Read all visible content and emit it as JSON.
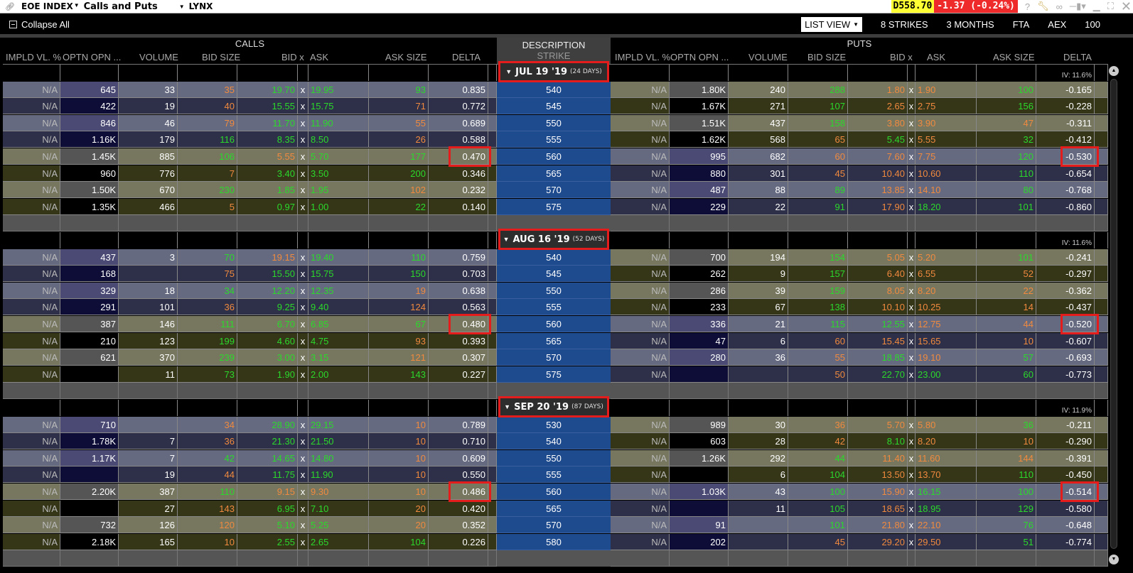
{
  "titlebar": {
    "symbol": "EOE INDEX",
    "title": "Calls and Puts",
    "account": "LYNX",
    "price": "D558.70",
    "change": "-1.37 (-0.24%)",
    "icons": [
      "help-icon",
      "wrench-icon",
      "link-icon",
      "pin-icon",
      "minimize-icon",
      "maximize-icon",
      "close-icon"
    ]
  },
  "toolbar": {
    "collapse_all": "Collapse All",
    "view": "LIST VIEW",
    "strikes": "8 STRIKES",
    "months": "3 MONTHS",
    "exchange1": "FTA",
    "exchange2": "AEX",
    "multiplier": "100"
  },
  "headers": {
    "calls": "CALLS",
    "puts": "PUTS",
    "description": "DESCRIPTION",
    "strike": "STRIKE",
    "columns": {
      "impl_vol": "IMPLD VL. %",
      "open_int": "OPTN OPN ...",
      "volume": "VOLUME",
      "bid_size": "BID SIZE",
      "bid_x": "BID x",
      "ask": "ASK",
      "ask_size": "ASK SIZE",
      "delta": "DELTA"
    }
  },
  "colors": {
    "up": "#2bd92b",
    "down": "#f08a3e",
    "strike_bg": "#1e4a8e",
    "highlight": "#e41c1c"
  },
  "expirations": [
    {
      "date": "JUL 19 '19",
      "days": "(24 DAYS)",
      "iv": "IV: 11.6%",
      "atm_strike": "560",
      "rows": [
        {
          "strike": "540",
          "c": {
            "iv": "N/A",
            "oi": "645",
            "vol": "33",
            "bs": "35",
            "bsc": "o",
            "bid": "19.70",
            "bidc": "g",
            "ask": "19.95",
            "askc": "g",
            "as": "93",
            "asc": "g",
            "delta": "0.835"
          },
          "p": {
            "iv": "N/A",
            "oi": "1.80K",
            "vol": "240",
            "bs": "288",
            "bsc": "g",
            "bid": "1.80",
            "bidc": "o",
            "ask": "1.90",
            "askc": "o",
            "as": "100",
            "asc": "g",
            "delta": "-0.165"
          }
        },
        {
          "strike": "545",
          "c": {
            "iv": "N/A",
            "oi": "422",
            "vol": "19",
            "bs": "40",
            "bsc": "o",
            "bid": "15.55",
            "bidc": "g",
            "ask": "15.75",
            "askc": "g",
            "as": "71",
            "asc": "o",
            "delta": "0.772"
          },
          "p": {
            "iv": "N/A",
            "oi": "1.67K",
            "vol": "271",
            "bs": "107",
            "bsc": "g",
            "bid": "2.65",
            "bidc": "o",
            "ask": "2.75",
            "askc": "o",
            "as": "156",
            "asc": "g",
            "delta": "-0.228"
          }
        },
        {
          "strike": "550",
          "c": {
            "iv": "N/A",
            "oi": "846",
            "vol": "46",
            "bs": "79",
            "bsc": "o",
            "bid": "11.70",
            "bidc": "g",
            "ask": "11.90",
            "askc": "g",
            "as": "55",
            "asc": "o",
            "delta": "0.689"
          },
          "p": {
            "iv": "N/A",
            "oi": "1.51K",
            "vol": "437",
            "bs": "158",
            "bsc": "g",
            "bid": "3.80",
            "bidc": "o",
            "ask": "3.90",
            "askc": "o",
            "as": "47",
            "asc": "o",
            "delta": "-0.311"
          }
        },
        {
          "strike": "555",
          "c": {
            "iv": "N/A",
            "oi": "1.16K",
            "vol": "179",
            "bs": "116",
            "bsc": "g",
            "bid": "8.35",
            "bidc": "g",
            "ask": "8.50",
            "askc": "g",
            "as": "26",
            "asc": "o",
            "delta": "0.588"
          },
          "p": {
            "iv": "N/A",
            "oi": "1.62K",
            "vol": "568",
            "bs": "65",
            "bsc": "o",
            "bid": "5.45",
            "bidc": "g",
            "ask": "5.55",
            "askc": "o",
            "as": "32",
            "asc": "g",
            "delta": "-0.412"
          }
        },
        {
          "strike": "560",
          "c": {
            "iv": "N/A",
            "oi": "1.45K",
            "vol": "885",
            "bs": "106",
            "bsc": "g",
            "bid": "5.55",
            "bidc": "o",
            "ask": "5.70",
            "askc": "g",
            "as": "177",
            "asc": "g",
            "delta": "0.470"
          },
          "p": {
            "iv": "N/A",
            "oi": "995",
            "vol": "682",
            "bs": "60",
            "bsc": "o",
            "bid": "7.60",
            "bidc": "o",
            "ask": "7.75",
            "askc": "o",
            "as": "120",
            "asc": "g",
            "delta": "-0.530"
          }
        },
        {
          "strike": "565",
          "c": {
            "iv": "N/A",
            "oi": "960",
            "vol": "776",
            "bs": "7",
            "bsc": "o",
            "bid": "3.40",
            "bidc": "g",
            "ask": "3.50",
            "askc": "g",
            "as": "200",
            "asc": "g",
            "delta": "0.346"
          },
          "p": {
            "iv": "N/A",
            "oi": "880",
            "vol": "301",
            "bs": "45",
            "bsc": "o",
            "bid": "10.40",
            "bidc": "o",
            "ask": "10.60",
            "askc": "o",
            "as": "110",
            "asc": "g",
            "delta": "-0.654"
          }
        },
        {
          "strike": "570",
          "c": {
            "iv": "N/A",
            "oi": "1.50K",
            "vol": "670",
            "bs": "230",
            "bsc": "g",
            "bid": "1.85",
            "bidc": "g",
            "ask": "1.95",
            "askc": "g",
            "as": "102",
            "asc": "o",
            "delta": "0.232"
          },
          "p": {
            "iv": "N/A",
            "oi": "487",
            "vol": "88",
            "bs": "89",
            "bsc": "g",
            "bid": "13.85",
            "bidc": "o",
            "ask": "14.10",
            "askc": "o",
            "as": "80",
            "asc": "g",
            "delta": "-0.768"
          }
        },
        {
          "strike": "575",
          "c": {
            "iv": "N/A",
            "oi": "1.35K",
            "vol": "466",
            "bs": "5",
            "bsc": "o",
            "bid": "0.97",
            "bidc": "g",
            "ask": "1.00",
            "askc": "g",
            "as": "22",
            "asc": "g",
            "delta": "0.140"
          },
          "p": {
            "iv": "N/A",
            "oi": "229",
            "vol": "22",
            "bs": "91",
            "bsc": "g",
            "bid": "17.90",
            "bidc": "o",
            "ask": "18.20",
            "askc": "g",
            "as": "101",
            "asc": "g",
            "delta": "-0.860"
          }
        }
      ]
    },
    {
      "date": "AUG 16 '19",
      "days": "(52 DAYS)",
      "iv": "IV: 11.6%",
      "atm_strike": "560",
      "rows": [
        {
          "strike": "540",
          "c": {
            "iv": "N/A",
            "oi": "437",
            "vol": "3",
            "bs": "70",
            "bsc": "g",
            "bid": "19.15",
            "bidc": "o",
            "ask": "19.40",
            "askc": "g",
            "as": "110",
            "asc": "g",
            "delta": "0.759"
          },
          "p": {
            "iv": "N/A",
            "oi": "700",
            "vol": "194",
            "bs": "154",
            "bsc": "g",
            "bid": "5.05",
            "bidc": "o",
            "ask": "5.20",
            "askc": "o",
            "as": "101",
            "asc": "g",
            "delta": "-0.241"
          }
        },
        {
          "strike": "545",
          "c": {
            "iv": "N/A",
            "oi": "168",
            "vol": "",
            "bs": "75",
            "bsc": "o",
            "bid": "15.50",
            "bidc": "g",
            "ask": "15.75",
            "askc": "g",
            "as": "150",
            "asc": "g",
            "delta": "0.703"
          },
          "p": {
            "iv": "N/A",
            "oi": "262",
            "vol": "9",
            "bs": "157",
            "bsc": "g",
            "bid": "6.40",
            "bidc": "o",
            "ask": "6.55",
            "askc": "o",
            "as": "52",
            "asc": "o",
            "delta": "-0.297"
          }
        },
        {
          "strike": "550",
          "c": {
            "iv": "N/A",
            "oi": "329",
            "vol": "18",
            "bs": "34",
            "bsc": "g",
            "bid": "12.20",
            "bidc": "g",
            "ask": "12.35",
            "askc": "g",
            "as": "19",
            "asc": "o",
            "delta": "0.638"
          },
          "p": {
            "iv": "N/A",
            "oi": "286",
            "vol": "39",
            "bs": "159",
            "bsc": "g",
            "bid": "8.05",
            "bidc": "o",
            "ask": "8.20",
            "askc": "o",
            "as": "22",
            "asc": "o",
            "delta": "-0.362"
          }
        },
        {
          "strike": "555",
          "c": {
            "iv": "N/A",
            "oi": "291",
            "vol": "101",
            "bs": "36",
            "bsc": "o",
            "bid": "9.25",
            "bidc": "g",
            "ask": "9.40",
            "askc": "g",
            "as": "124",
            "asc": "o",
            "delta": "0.563"
          },
          "p": {
            "iv": "N/A",
            "oi": "233",
            "vol": "67",
            "bs": "138",
            "bsc": "g",
            "bid": "10.10",
            "bidc": "o",
            "ask": "10.25",
            "askc": "o",
            "as": "14",
            "asc": "o",
            "delta": "-0.437"
          }
        },
        {
          "strike": "560",
          "c": {
            "iv": "N/A",
            "oi": "387",
            "vol": "146",
            "bs": "111",
            "bsc": "g",
            "bid": "6.70",
            "bidc": "g",
            "ask": "6.85",
            "askc": "g",
            "as": "67",
            "asc": "g",
            "delta": "0.480"
          },
          "p": {
            "iv": "N/A",
            "oi": "336",
            "vol": "21",
            "bs": "115",
            "bsc": "g",
            "bid": "12.55",
            "bidc": "g",
            "ask": "12.75",
            "askc": "o",
            "as": "44",
            "asc": "o",
            "delta": "-0.520"
          }
        },
        {
          "strike": "565",
          "c": {
            "iv": "N/A",
            "oi": "210",
            "vol": "123",
            "bs": "199",
            "bsc": "g",
            "bid": "4.60",
            "bidc": "g",
            "ask": "4.75",
            "askc": "g",
            "as": "93",
            "asc": "o",
            "delta": "0.393"
          },
          "p": {
            "iv": "N/A",
            "oi": "47",
            "vol": "6",
            "bs": "60",
            "bsc": "o",
            "bid": "15.45",
            "bidc": "o",
            "ask": "15.65",
            "askc": "o",
            "as": "10",
            "asc": "o",
            "delta": "-0.607"
          }
        },
        {
          "strike": "570",
          "c": {
            "iv": "N/A",
            "oi": "621",
            "vol": "370",
            "bs": "239",
            "bsc": "g",
            "bid": "3.00",
            "bidc": "g",
            "ask": "3.15",
            "askc": "g",
            "as": "121",
            "asc": "o",
            "delta": "0.307"
          },
          "p": {
            "iv": "N/A",
            "oi": "280",
            "vol": "36",
            "bs": "55",
            "bsc": "o",
            "bid": "18.85",
            "bidc": "g",
            "ask": "19.10",
            "askc": "o",
            "as": "57",
            "asc": "g",
            "delta": "-0.693"
          }
        },
        {
          "strike": "575",
          "c": {
            "iv": "N/A",
            "oi": "",
            "vol": "11",
            "bs": "73",
            "bsc": "g",
            "bid": "1.90",
            "bidc": "g",
            "ask": "2.00",
            "askc": "g",
            "as": "143",
            "asc": "g",
            "delta": "0.227"
          },
          "p": {
            "iv": "N/A",
            "oi": "",
            "vol": "",
            "bs": "50",
            "bsc": "o",
            "bid": "22.70",
            "bidc": "g",
            "ask": "23.00",
            "askc": "g",
            "as": "60",
            "asc": "g",
            "delta": "-0.773"
          }
        }
      ]
    },
    {
      "date": "SEP 20 '19",
      "days": "(87 DAYS)",
      "iv": "IV: 11.9%",
      "atm_strike": "560",
      "rows": [
        {
          "strike": "530",
          "c": {
            "iv": "N/A",
            "oi": "710",
            "vol": "",
            "bs": "34",
            "bsc": "o",
            "bid": "28.90",
            "bidc": "g",
            "ask": "29.15",
            "askc": "g",
            "as": "10",
            "asc": "o",
            "delta": "0.789"
          },
          "p": {
            "iv": "N/A",
            "oi": "989",
            "vol": "30",
            "bs": "36",
            "bsc": "o",
            "bid": "5.70",
            "bidc": "o",
            "ask": "5.80",
            "askc": "o",
            "as": "36",
            "asc": "g",
            "delta": "-0.211"
          }
        },
        {
          "strike": "540",
          "c": {
            "iv": "N/A",
            "oi": "1.78K",
            "vol": "7",
            "bs": "36",
            "bsc": "o",
            "bid": "21.30",
            "bidc": "g",
            "ask": "21.50",
            "askc": "g",
            "as": "10",
            "asc": "o",
            "delta": "0.710"
          },
          "p": {
            "iv": "N/A",
            "oi": "603",
            "vol": "28",
            "bs": "42",
            "bsc": "o",
            "bid": "8.10",
            "bidc": "g",
            "ask": "8.20",
            "askc": "o",
            "as": "10",
            "asc": "o",
            "delta": "-0.290"
          }
        },
        {
          "strike": "550",
          "c": {
            "iv": "N/A",
            "oi": "1.17K",
            "vol": "7",
            "bs": "42",
            "bsc": "g",
            "bid": "14.65",
            "bidc": "g",
            "ask": "14.80",
            "askc": "g",
            "as": "10",
            "asc": "o",
            "delta": "0.609"
          },
          "p": {
            "iv": "N/A",
            "oi": "1.26K",
            "vol": "292",
            "bs": "44",
            "bsc": "g",
            "bid": "11.40",
            "bidc": "o",
            "ask": "11.60",
            "askc": "o",
            "as": "144",
            "asc": "o",
            "delta": "-0.391"
          }
        },
        {
          "strike": "555",
          "c": {
            "iv": "N/A",
            "oi": "",
            "vol": "19",
            "bs": "44",
            "bsc": "o",
            "bid": "11.75",
            "bidc": "g",
            "ask": "11.90",
            "askc": "g",
            "as": "10",
            "asc": "o",
            "delta": "0.550"
          },
          "p": {
            "iv": "N/A",
            "oi": "",
            "vol": "6",
            "bs": "104",
            "bsc": "g",
            "bid": "13.50",
            "bidc": "o",
            "ask": "13.70",
            "askc": "o",
            "as": "110",
            "asc": "g",
            "delta": "-0.450"
          }
        },
        {
          "strike": "560",
          "c": {
            "iv": "N/A",
            "oi": "2.20K",
            "vol": "387",
            "bs": "110",
            "bsc": "g",
            "bid": "9.15",
            "bidc": "o",
            "ask": "9.30",
            "askc": "o",
            "as": "10",
            "asc": "o",
            "delta": "0.486"
          },
          "p": {
            "iv": "N/A",
            "oi": "1.03K",
            "vol": "43",
            "bs": "100",
            "bsc": "g",
            "bid": "15.90",
            "bidc": "o",
            "ask": "16.15",
            "askc": "g",
            "as": "100",
            "asc": "g",
            "delta": "-0.514"
          }
        },
        {
          "strike": "565",
          "c": {
            "iv": "N/A",
            "oi": "",
            "vol": "27",
            "bs": "143",
            "bsc": "o",
            "bid": "6.95",
            "bidc": "g",
            "ask": "7.10",
            "askc": "g",
            "as": "20",
            "asc": "o",
            "delta": "0.420"
          },
          "p": {
            "iv": "N/A",
            "oi": "",
            "vol": "11",
            "bs": "105",
            "bsc": "g",
            "bid": "18.65",
            "bidc": "o",
            "ask": "18.95",
            "askc": "g",
            "as": "129",
            "asc": "g",
            "delta": "-0.580"
          }
        },
        {
          "strike": "570",
          "c": {
            "iv": "N/A",
            "oi": "732",
            "vol": "126",
            "bs": "120",
            "bsc": "o",
            "bid": "5.10",
            "bidc": "g",
            "ask": "5.25",
            "askc": "g",
            "as": "20",
            "asc": "o",
            "delta": "0.352"
          },
          "p": {
            "iv": "N/A",
            "oi": "91",
            "vol": "",
            "bs": "101",
            "bsc": "g",
            "bid": "21.80",
            "bidc": "o",
            "ask": "22.10",
            "askc": "o",
            "as": "76",
            "asc": "g",
            "delta": "-0.648"
          }
        },
        {
          "strike": "580",
          "c": {
            "iv": "N/A",
            "oi": "2.18K",
            "vol": "165",
            "bs": "10",
            "bsc": "o",
            "bid": "2.55",
            "bidc": "g",
            "ask": "2.65",
            "askc": "g",
            "as": "104",
            "asc": "g",
            "delta": "0.226"
          },
          "p": {
            "iv": "N/A",
            "oi": "202",
            "vol": "",
            "bs": "45",
            "bsc": "o",
            "bid": "29.20",
            "bidc": "o",
            "ask": "29.50",
            "askc": "o",
            "as": "51",
            "asc": "g",
            "delta": "-0.774"
          }
        }
      ]
    }
  ]
}
